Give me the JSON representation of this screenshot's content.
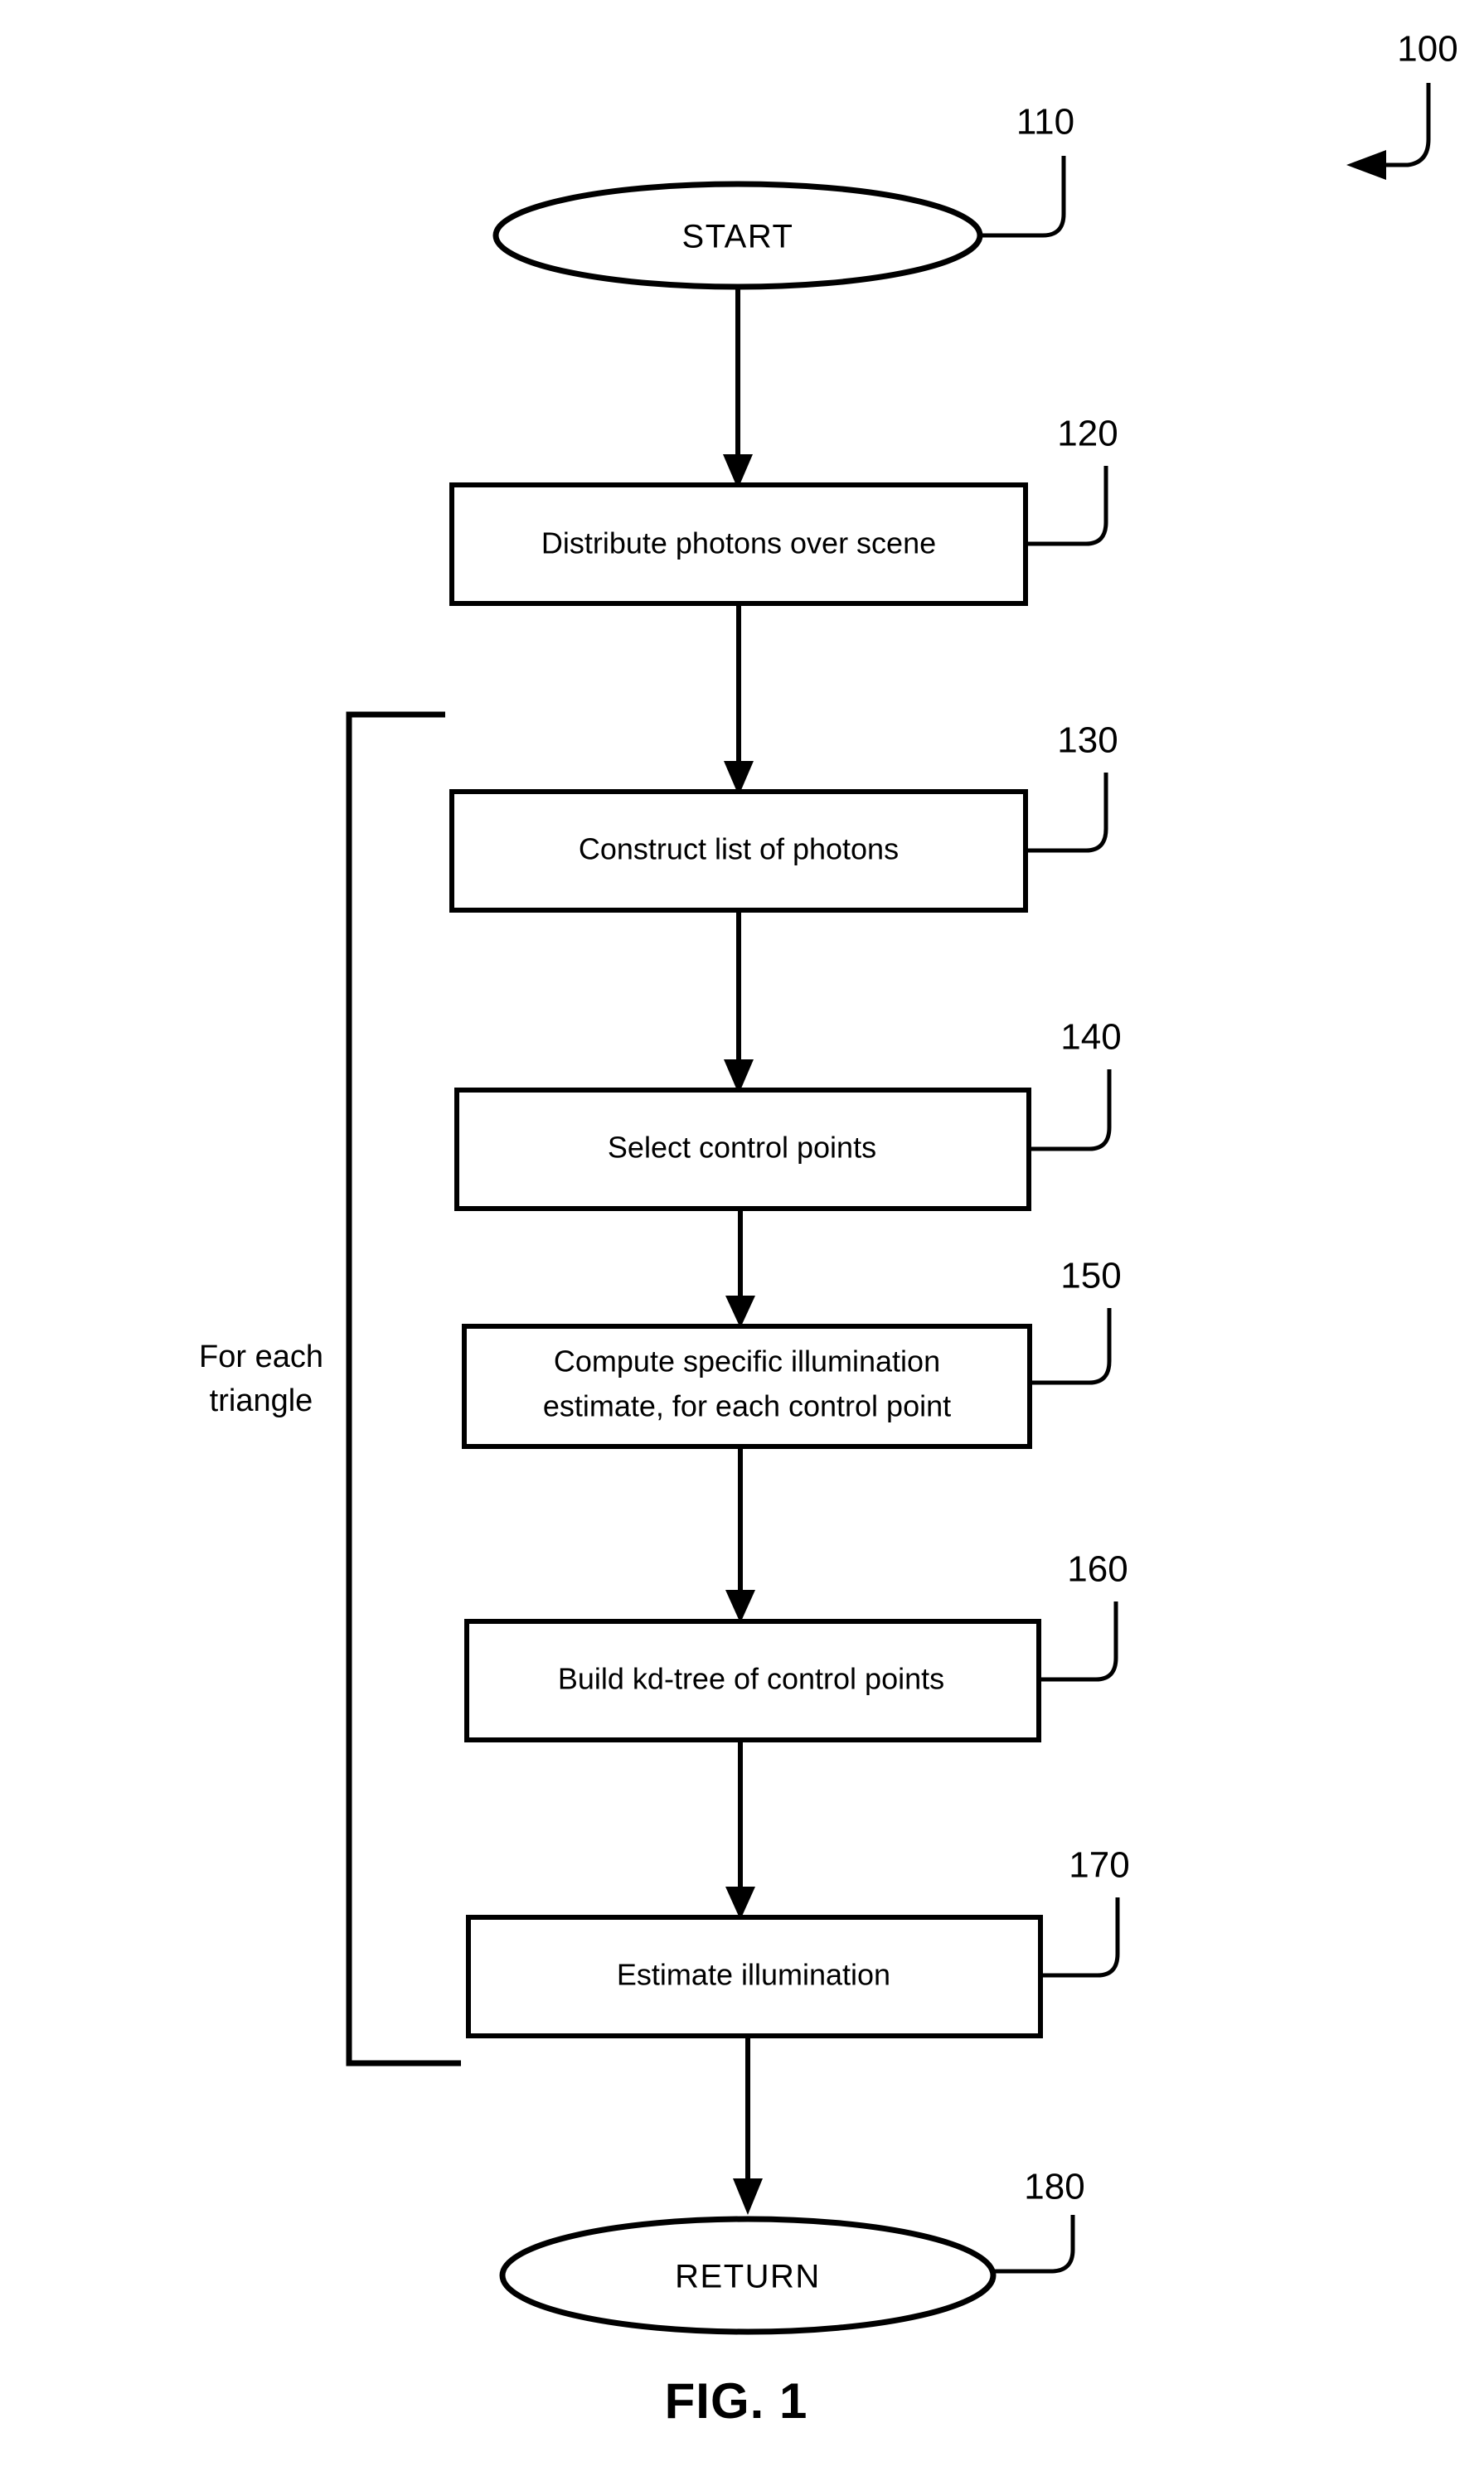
{
  "figure": {
    "caption": "FIG. 1",
    "diagram_reference": "100"
  },
  "nodes": {
    "start": {
      "label": "START",
      "ref": "110",
      "shape": "ellipse"
    },
    "step_120": {
      "label": "Distribute photons over scene",
      "ref": "120",
      "shape": "process"
    },
    "step_130": {
      "label": "Construct list of photons",
      "ref": "130",
      "shape": "process"
    },
    "step_140": {
      "label": "Select control points",
      "ref": "140",
      "shape": "process"
    },
    "step_150": {
      "label_line1": "Compute specific illumination",
      "label_line2": "estimate, for each control point",
      "ref": "150",
      "shape": "process"
    },
    "step_160": {
      "label": "Build kd-tree of control points",
      "ref": "160",
      "shape": "process"
    },
    "step_170": {
      "label": "Estimate illumination",
      "ref": "170",
      "shape": "process"
    },
    "return": {
      "label": "RETURN",
      "ref": "180",
      "shape": "ellipse"
    }
  },
  "loop": {
    "label_line1": "For each",
    "label_line2": "triangle"
  },
  "colors": {
    "ink": "#000000",
    "paper": "#ffffff"
  }
}
